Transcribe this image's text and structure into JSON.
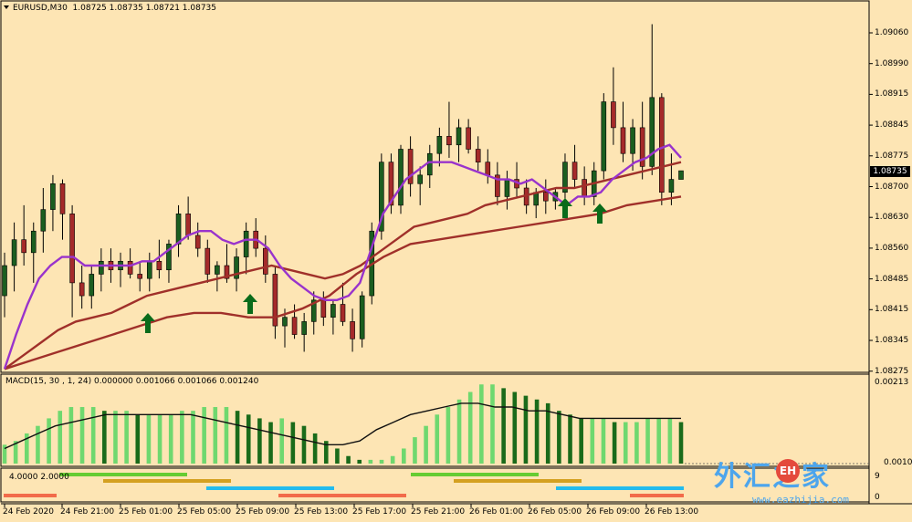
{
  "main": {
    "title": "EURUSD,M30  1.08725 1.08735 1.08721 1.08735",
    "current_price": "1.08735",
    "y_ticks": [
      "1.09060",
      "1.08990",
      "1.08915",
      "1.08845",
      "1.08775",
      "1.08700",
      "1.08630",
      "1.08560",
      "1.08485",
      "1.08415",
      "1.08345",
      "1.08275"
    ]
  },
  "macd": {
    "title": "MACD(15, 30 , 1, 24) 0.000000 0.001066 0.001066 0.001240",
    "y_ticks": [
      "0.00213",
      "0.00101"
    ]
  },
  "bands": {
    "label": "4.0000 2.0000",
    "y_ticks": [
      "9",
      "0"
    ]
  },
  "x_ticks": [
    "24 Feb 2020",
    "24 Feb 21:00",
    "25 Feb 01:00",
    "25 Feb 05:00",
    "25 Feb 09:00",
    "25 Feb 13:00",
    "25 Feb 17:00",
    "25 Feb 21:00",
    "26 Feb 01:00",
    "26 Feb 05:00",
    "26 Feb 09:00",
    "26 Feb 13:00"
  ],
  "watermark": {
    "cn": "外汇之家",
    "logo": "EH",
    "url": "www.eazhijia.com"
  },
  "colors": {
    "bg": "#fde5b4",
    "bull": "#1b5e20",
    "bear": "#a52a2a",
    "ma_fast": "#9933cc",
    "ma_slow": "#a0302a",
    "macd_light": "#6fd86f",
    "macd_dark": "#1a6b1a",
    "arrow": "#0a6b1a"
  },
  "chart_data": {
    "type": "candlestick",
    "symbol": "EURUSD",
    "timeframe": "M30",
    "ylim": [
      1.0826,
      1.091
    ],
    "ohlc": [
      [
        1.0845,
        1.0855,
        1.084,
        1.0852
      ],
      [
        1.0852,
        1.0862,
        1.0846,
        1.0858
      ],
      [
        1.0858,
        1.0866,
        1.0852,
        1.0855
      ],
      [
        1.0855,
        1.0862,
        1.0848,
        1.086
      ],
      [
        1.086,
        1.087,
        1.0855,
        1.0865
      ],
      [
        1.0865,
        1.0873,
        1.086,
        1.0871
      ],
      [
        1.0871,
        1.0872,
        1.0858,
        1.0864
      ],
      [
        1.0864,
        1.0866,
        1.084,
        1.0848
      ],
      [
        1.0848,
        1.0852,
        1.0842,
        1.0845
      ],
      [
        1.0845,
        1.0852,
        1.0842,
        1.085
      ],
      [
        1.085,
        1.0856,
        1.0846,
        1.0853
      ],
      [
        1.0853,
        1.0856,
        1.0848,
        1.0851
      ],
      [
        1.0851,
        1.0855,
        1.0847,
        1.0853
      ],
      [
        1.0853,
        1.0856,
        1.0849,
        1.085
      ],
      [
        1.085,
        1.0853,
        1.0846,
        1.0849
      ],
      [
        1.0849,
        1.0855,
        1.0846,
        1.0853
      ],
      [
        1.0853,
        1.0858,
        1.0849,
        1.0851
      ],
      [
        1.0851,
        1.0858,
        1.0848,
        1.0857
      ],
      [
        1.0857,
        1.0866,
        1.0854,
        1.0864
      ],
      [
        1.0864,
        1.0868,
        1.0858,
        1.0859
      ],
      [
        1.0859,
        1.0862,
        1.0854,
        1.0856
      ],
      [
        1.0856,
        1.0858,
        1.0848,
        1.085
      ],
      [
        1.085,
        1.0853,
        1.0846,
        1.0852
      ],
      [
        1.0852,
        1.0857,
        1.0848,
        1.0849
      ],
      [
        1.0849,
        1.0856,
        1.0846,
        1.0854
      ],
      [
        1.0854,
        1.0862,
        1.085,
        1.086
      ],
      [
        1.086,
        1.0863,
        1.0854,
        1.0856
      ],
      [
        1.0856,
        1.0859,
        1.0848,
        1.085
      ],
      [
        1.085,
        1.0852,
        1.0835,
        1.0838
      ],
      [
        1.0838,
        1.0842,
        1.0833,
        1.084
      ],
      [
        1.084,
        1.0843,
        1.0835,
        1.0836
      ],
      [
        1.0836,
        1.0841,
        1.0832,
        1.0839
      ],
      [
        1.0839,
        1.0846,
        1.0836,
        1.0844
      ],
      [
        1.0844,
        1.0846,
        1.0838,
        1.084
      ],
      [
        1.084,
        1.0844,
        1.0836,
        1.0843
      ],
      [
        1.0843,
        1.0848,
        1.0838,
        1.0839
      ],
      [
        1.0839,
        1.0842,
        1.0832,
        1.0835
      ],
      [
        1.0835,
        1.0846,
        1.0833,
        1.0845
      ],
      [
        1.0845,
        1.0862,
        1.0843,
        1.086
      ],
      [
        1.086,
        1.0878,
        1.0858,
        1.0876
      ],
      [
        1.0876,
        1.0878,
        1.0864,
        1.0866
      ],
      [
        1.0866,
        1.088,
        1.0864,
        1.0879
      ],
      [
        1.0879,
        1.0882,
        1.0868,
        1.0871
      ],
      [
        1.0871,
        1.0875,
        1.0866,
        1.0873
      ],
      [
        1.0873,
        1.088,
        1.087,
        1.0878
      ],
      [
        1.0878,
        1.0884,
        1.0875,
        1.0882
      ],
      [
        1.0882,
        1.089,
        1.0877,
        1.088
      ],
      [
        1.088,
        1.0886,
        1.0876,
        1.0884
      ],
      [
        1.0884,
        1.0886,
        1.0878,
        1.0879
      ],
      [
        1.0879,
        1.0882,
        1.0874,
        1.0876
      ],
      [
        1.0876,
        1.0879,
        1.0871,
        1.0873
      ],
      [
        1.0873,
        1.0876,
        1.0866,
        1.0868
      ],
      [
        1.0868,
        1.0874,
        1.0865,
        1.0872
      ],
      [
        1.0872,
        1.0876,
        1.0868,
        1.087
      ],
      [
        1.087,
        1.0872,
        1.0864,
        1.0866
      ],
      [
        1.0866,
        1.087,
        1.0863,
        1.0869
      ],
      [
        1.0869,
        1.0872,
        1.0864,
        1.0867
      ],
      [
        1.0867,
        1.087,
        1.0865,
        1.0869
      ],
      [
        1.0869,
        1.0878,
        1.0867,
        1.0876
      ],
      [
        1.0876,
        1.088,
        1.087,
        1.0872
      ],
      [
        1.0872,
        1.0875,
        1.0866,
        1.0868
      ],
      [
        1.0868,
        1.0876,
        1.0866,
        1.0874
      ],
      [
        1.0874,
        1.0892,
        1.0872,
        1.089
      ],
      [
        1.089,
        1.0898,
        1.088,
        1.0884
      ],
      [
        1.0884,
        1.089,
        1.0876,
        1.0878
      ],
      [
        1.0878,
        1.0886,
        1.0874,
        1.0884
      ],
      [
        1.0884,
        1.089,
        1.0872,
        1.0875
      ],
      [
        1.0875,
        1.0908,
        1.0873,
        1.0891
      ],
      [
        1.0891,
        1.0892,
        1.0866,
        1.0869
      ],
      [
        1.0869,
        1.0878,
        1.0866,
        1.0872
      ],
      [
        1.0872,
        1.0874,
        1.0872,
        1.0874
      ]
    ],
    "ma_fast": [
      1.0828,
      1.0836,
      1.0843,
      1.0849,
      1.0852,
      1.0854,
      1.0854,
      1.0852,
      1.0852,
      1.0852,
      1.0852,
      1.0852,
      1.0853,
      1.0853,
      1.0855,
      1.0857,
      1.0859,
      1.086,
      1.086,
      1.0858,
      1.0857,
      1.0858,
      1.0858,
      1.0856,
      1.0852,
      1.0849,
      1.0847,
      1.0845,
      1.0844,
      1.0844,
      1.0845,
      1.0848,
      1.0856,
      1.0864,
      1.0868,
      1.0872,
      1.0874,
      1.0876,
      1.0876,
      1.0876,
      1.0875,
      1.0874,
      1.0873,
      1.0872,
      1.0872,
      1.0871,
      1.0872,
      1.087,
      1.0868,
      1.0866,
      1.0868,
      1.0868,
      1.0869,
      1.0872,
      1.0874,
      1.0876,
      1.0877,
      1.0879,
      1.088,
      1.0877
    ],
    "ma_slow": [
      1.0828,
      1.0831,
      1.0834,
      1.0837,
      1.0839,
      1.084,
      1.0841,
      1.0843,
      1.0845,
      1.0846,
      1.0847,
      1.0848,
      1.0849,
      1.085,
      1.0851,
      1.0852,
      1.0851,
      1.085,
      1.0849,
      1.085,
      1.0852,
      1.0855,
      1.0858,
      1.0861,
      1.0862,
      1.0863,
      1.0864,
      1.0866,
      1.0867,
      1.0868,
      1.0869,
      1.087,
      1.087,
      1.0871,
      1.0872,
      1.0873,
      1.0874,
      1.0875,
      1.0876
    ],
    "ma_slow2": [
      1.0828,
      1.083,
      1.0832,
      1.0834,
      1.0836,
      1.0838,
      1.084,
      1.0841,
      1.0841,
      1.084,
      1.084,
      1.0842,
      1.0845,
      1.085,
      1.0854,
      1.0857,
      1.0858,
      1.0859,
      1.086,
      1.0861,
      1.0862,
      1.0863,
      1.0864,
      1.0866,
      1.0867,
      1.0868
    ],
    "macd_hist": [
      0.0005,
      0.0006,
      0.0008,
      0.001,
      0.0012,
      0.0014,
      0.0015,
      0.0015,
      0.0015,
      0.0014,
      0.0014,
      0.0014,
      0.0013,
      0.0013,
      0.0013,
      0.0013,
      0.0014,
      0.0014,
      0.0015,
      0.0015,
      0.0015,
      0.0014,
      0.0013,
      0.0012,
      0.0011,
      0.0012,
      0.0011,
      0.001,
      0.0008,
      0.0006,
      0.0004,
      0.0002,
      0.0001,
      0.0001,
      0.0001,
      0.0002,
      0.0004,
      0.0007,
      0.001,
      0.0013,
      0.0015,
      0.0017,
      0.0019,
      0.0021,
      0.0021,
      0.002,
      0.0019,
      0.0018,
      0.0017,
      0.0016,
      0.0014,
      0.0013,
      0.0012,
      0.0012,
      0.0012,
      0.0011,
      0.0011,
      0.0011,
      0.0012,
      0.0012,
      0.0012,
      0.0011
    ],
    "macd_signal": [
      0.0004,
      0.0006,
      0.0008,
      0.001,
      0.0011,
      0.0012,
      0.0013,
      0.0013,
      0.0013,
      0.0013,
      0.0013,
      0.0013,
      0.0012,
      0.0011,
      0.001,
      0.0009,
      0.0008,
      0.0007,
      0.0006,
      0.0005,
      0.0005,
      0.0006,
      0.0009,
      0.0011,
      0.0013,
      0.0014,
      0.0015,
      0.0016,
      0.0016,
      0.0015,
      0.0015,
      0.0014,
      0.0014,
      0.0013,
      0.0012,
      0.0012,
      0.0012,
      0.0012,
      0.0012,
      0.0012,
      0.0012
    ]
  }
}
